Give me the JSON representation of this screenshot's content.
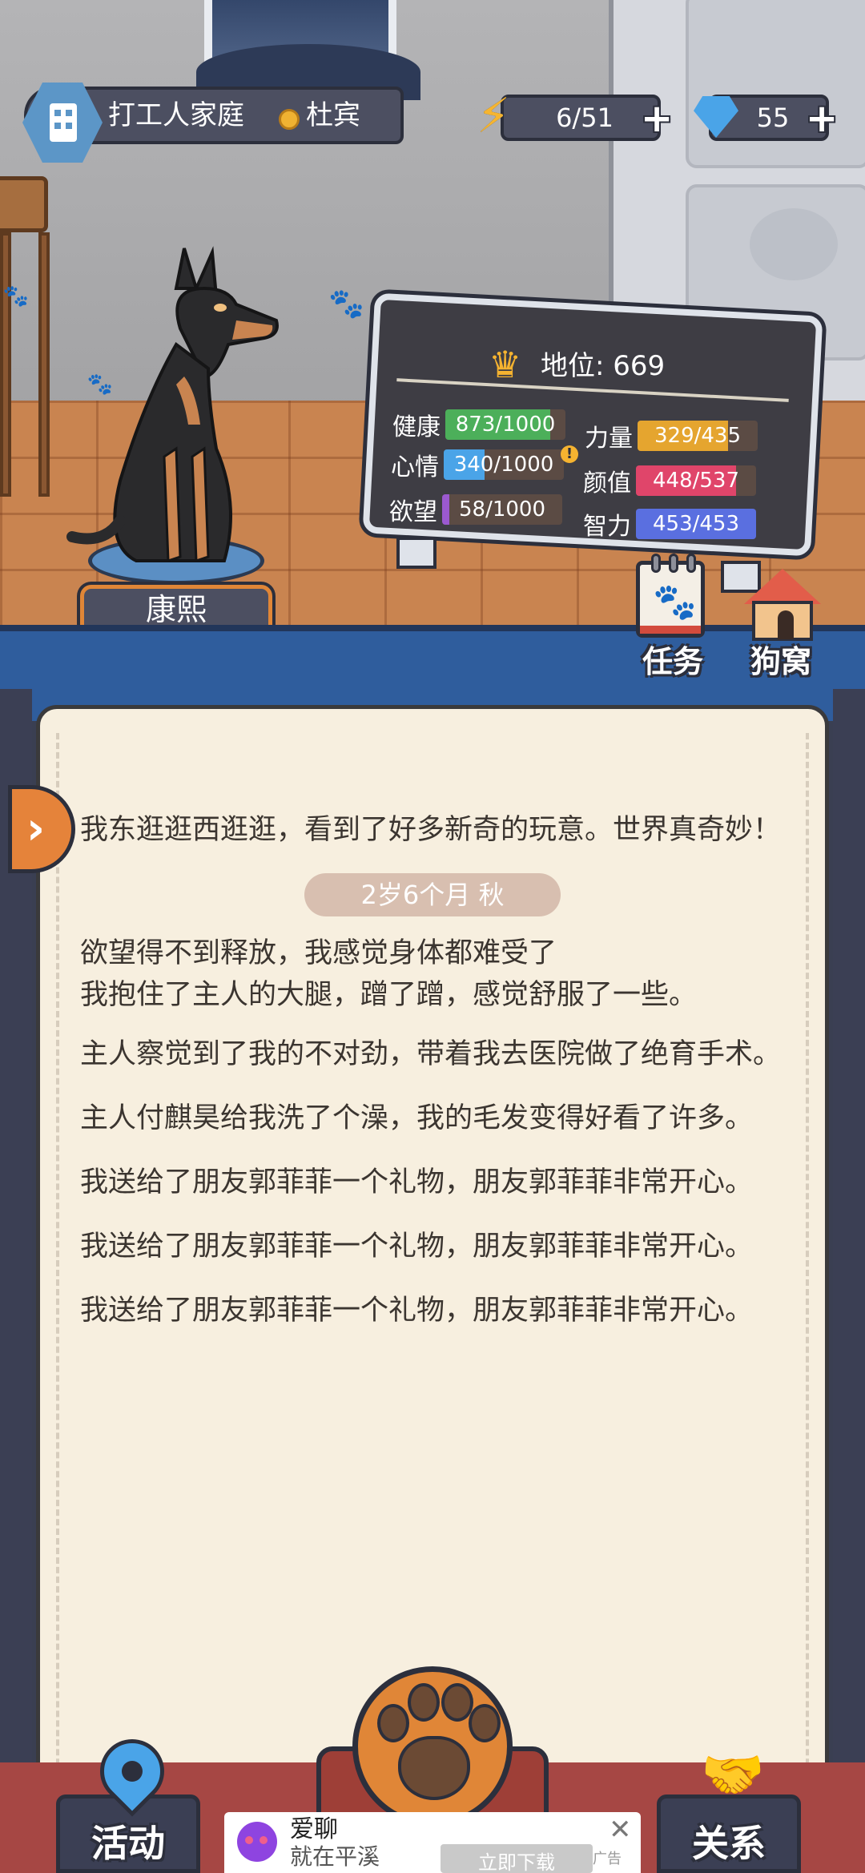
{
  "header": {
    "family_name": "打工人家庭",
    "owner_name": "杜宾",
    "energy": "6/51",
    "gems": "55"
  },
  "dog": {
    "name": "康熙"
  },
  "stats": {
    "status_label": "地位: 669",
    "items": [
      {
        "label": "健康",
        "value": "873/1000",
        "fraction": 0.873,
        "color": "#4caf5a"
      },
      {
        "label": "力量",
        "value": "329/435",
        "fraction": 0.756,
        "color": "#e5a52f"
      },
      {
        "label": "心情",
        "value": "340/1000",
        "fraction": 0.34,
        "color": "#4aa4e8"
      },
      {
        "label": "颜值",
        "value": "448/537",
        "fraction": 0.834,
        "color": "#e0456a"
      },
      {
        "label": "欲望",
        "value": "58/1000",
        "fraction": 0.058,
        "color": "#9b59d0"
      },
      {
        "label": "智力",
        "value": "453/453",
        "fraction": 1.0,
        "color": "#5a6fe0"
      }
    ]
  },
  "side_buttons": {
    "task": "任务",
    "kennel": "狗窝"
  },
  "diary": {
    "first_entry": "我东逛逛西逛逛，看到了好多新奇的玩意。世界真奇妙！",
    "age_badge": "2岁6个月 秋",
    "entries": [
      "欲望得不到释放，我感觉身体都难受了\n我抱住了主人的大腿，蹭了蹭，感觉舒服了一些。",
      "主人察觉到了我的不对劲，带着我去医院做了绝育手术。",
      "主人付麒昊给我洗了个澡，我的毛发变得好看了许多。",
      "我送给了朋友郭菲菲一个礼物，朋友郭菲菲非常开心。",
      "我送给了朋友郭菲菲一个礼物，朋友郭菲菲非常开心。",
      "我送给了朋友郭菲菲一个礼物，朋友郭菲菲非常开心。"
    ]
  },
  "nav": {
    "activity": "活动",
    "relation": "关系"
  },
  "ad": {
    "title": "爱聊",
    "subtitle": "就在平溪",
    "button": "立即下载",
    "tag": "广告",
    "close": "✕"
  },
  "icons": {
    "energy": "lightning-icon",
    "gem": "diamond-icon",
    "crown": "crown-icon",
    "paw": "paw-icon"
  }
}
